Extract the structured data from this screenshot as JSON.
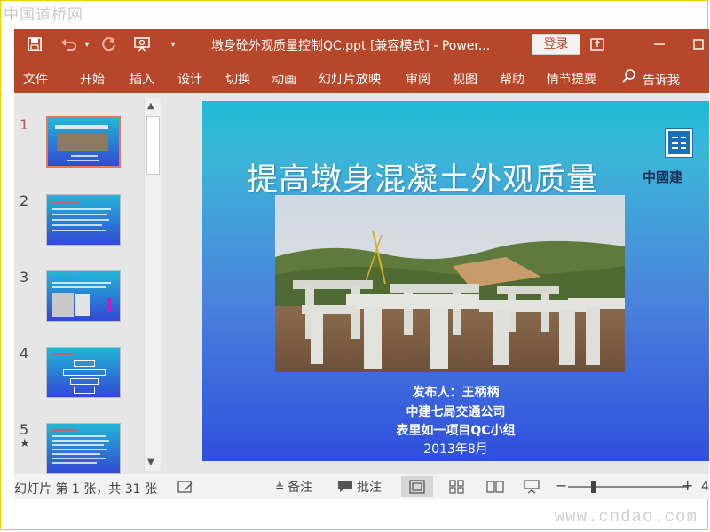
{
  "watermarks": {
    "top": "中国道桥网",
    "bottom": "www.cndao.com"
  },
  "window": {
    "title": "墩身砼外观质量控制QC.ppt [兼容模式] - Power...",
    "login_label": "登录"
  },
  "ribbon": {
    "tabs": [
      "文件",
      "开始",
      "插入",
      "设计",
      "切换",
      "动画",
      "幻灯片放映",
      "审阅",
      "视图",
      "帮助",
      "情节提要"
    ],
    "tell_me": "告诉我"
  },
  "thumbnails": [
    {
      "number": "1",
      "selected": true
    },
    {
      "number": "2"
    },
    {
      "number": "3"
    },
    {
      "number": "4"
    },
    {
      "number": "5",
      "star": "★"
    }
  ],
  "slide": {
    "title": "提高墩身混凝土外观质量",
    "logo_text": "中國建",
    "lines": [
      "发布人：王柄柄",
      "中建七局交通公司",
      "表里如一项目QC小组",
      "2013年8月"
    ]
  },
  "status": {
    "slide_info": "幻灯片 第 1 张，共 31 张",
    "notes_label": "备注",
    "comments_label": "批注",
    "zoom_minus": "−",
    "zoom_plus": "+",
    "zoom_value": "4"
  },
  "colors": {
    "accent": "#b7472a",
    "slide_top": "#1dbad6",
    "slide_bottom": "#2f4fdc"
  }
}
